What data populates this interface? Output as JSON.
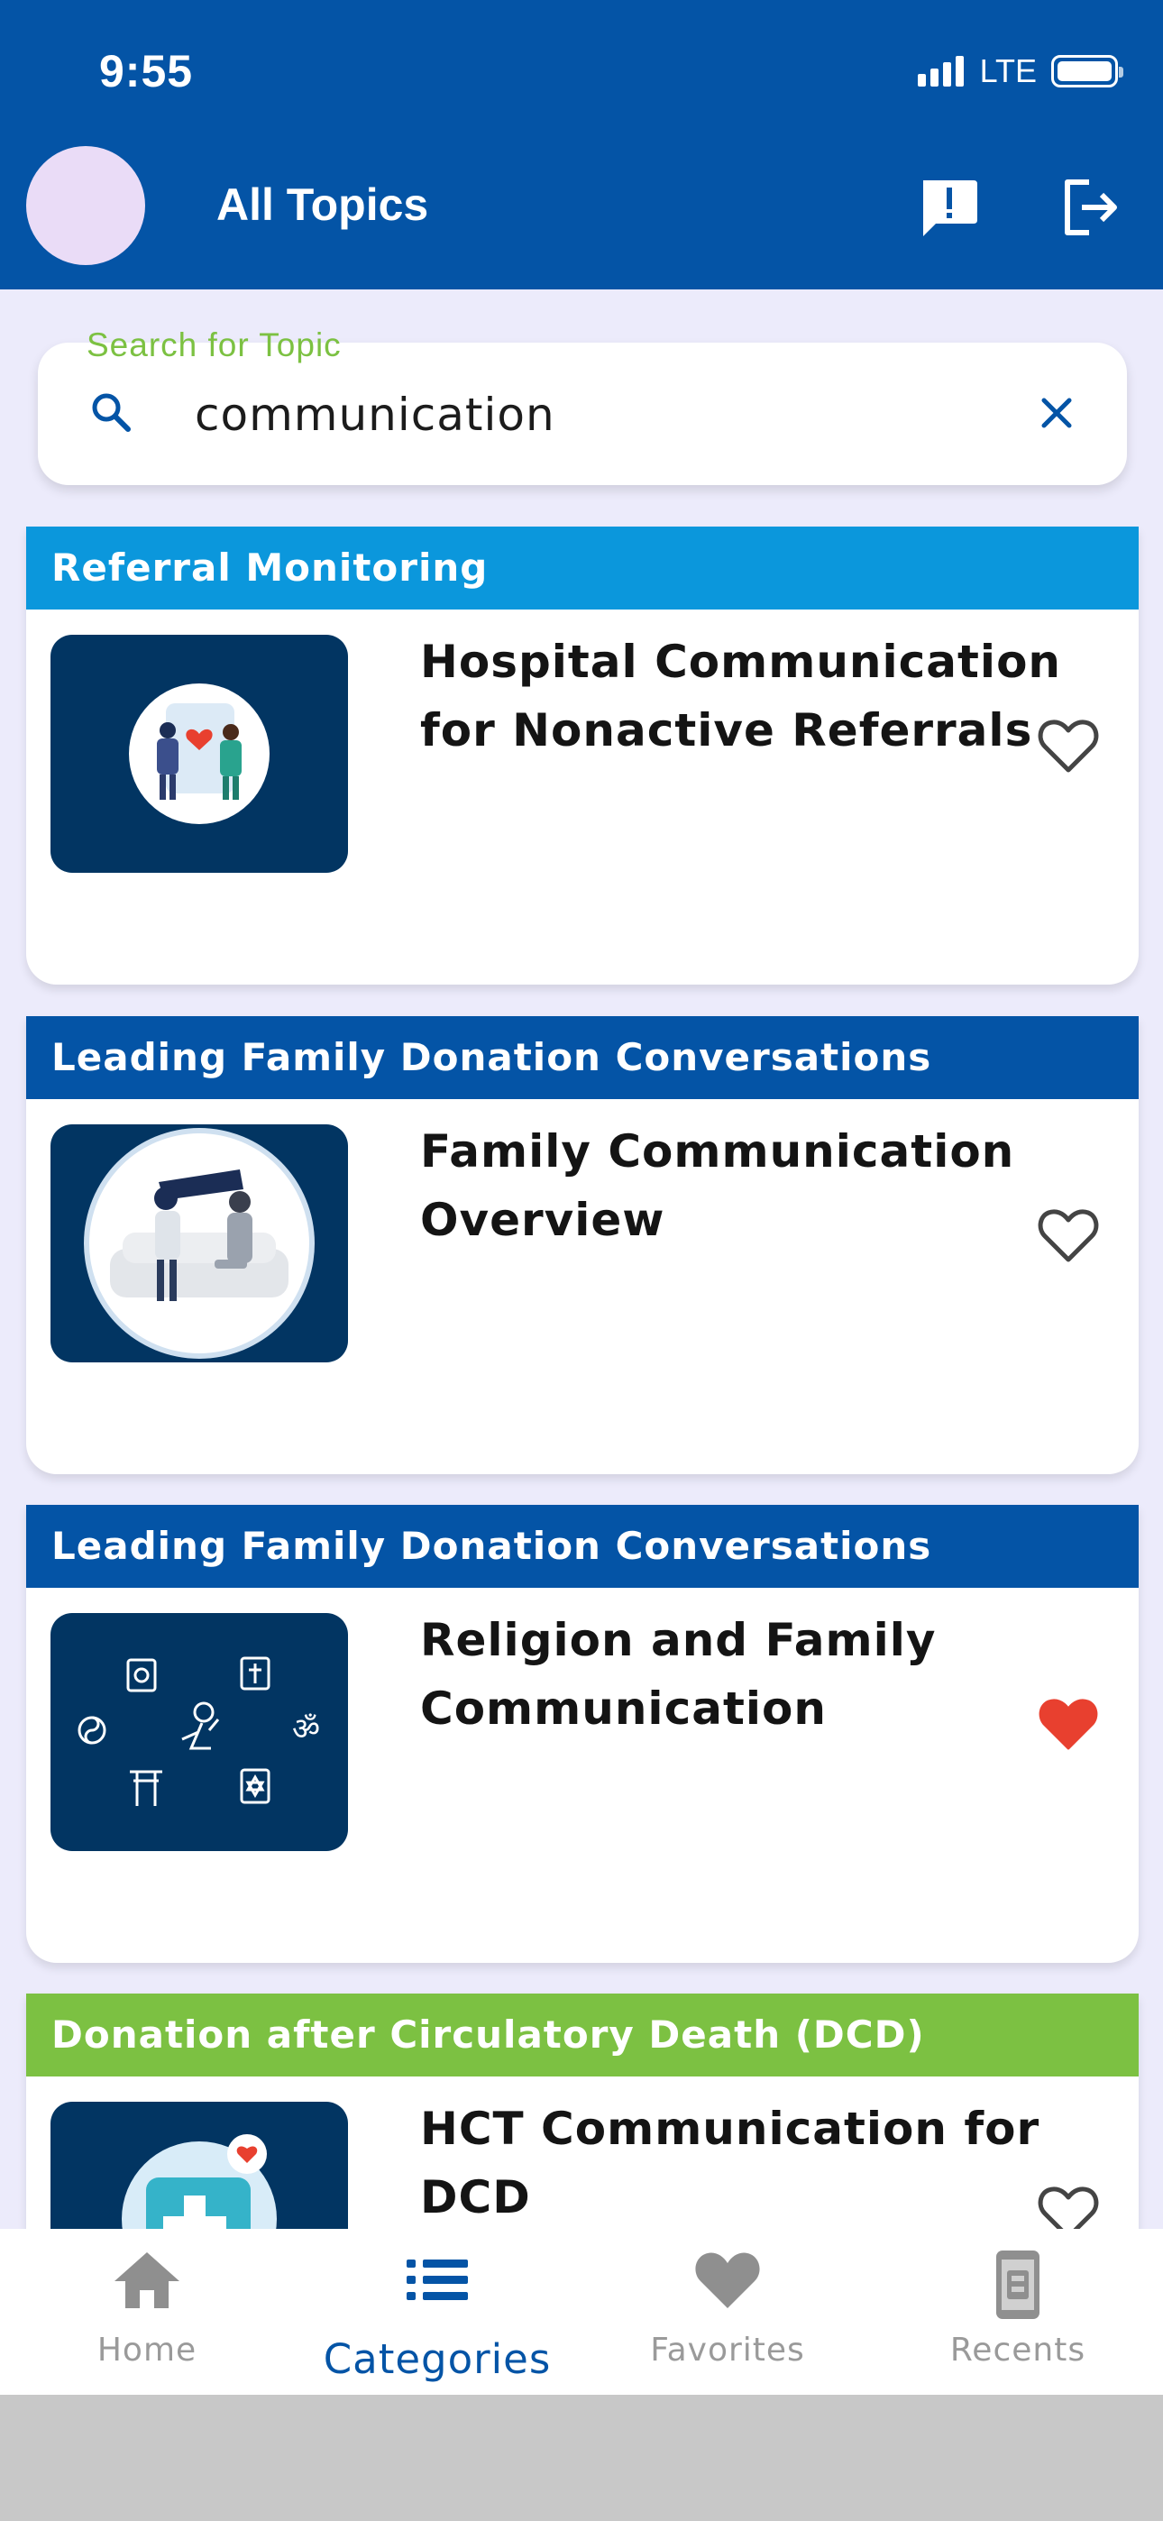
{
  "status_bar": {
    "time": "9:55",
    "network": "LTE"
  },
  "header": {
    "title": "All Topics"
  },
  "search": {
    "label": "Search for Topic",
    "value": "communication"
  },
  "colors": {
    "brand_blue": "#0454a6",
    "light_blue": "#0b97dc",
    "green": "#7cc142",
    "favorite_red": "#e8402f"
  },
  "cards": [
    {
      "category": "Referral Monitoring",
      "category_color": "#0b97dc",
      "title": "Hospital Communication for Nonactive Referrals",
      "favorite": false,
      "image_icon": "hospital-staff-illustration"
    },
    {
      "category": "Leading Family Donation Conversations",
      "category_color": "#0454a6",
      "title": "Family Communication Overview",
      "favorite": false,
      "image_icon": "family-conversation-illustration"
    },
    {
      "category": "Leading Family Donation Conversations",
      "category_color": "#0454a6",
      "title": "Religion and Family Communication",
      "favorite": true,
      "image_icon": "religion-symbols-illustration"
    },
    {
      "category": "Donation after Circulatory Death (DCD)",
      "category_color": "#7cc142",
      "title": "HCT Communication for DCD",
      "favorite": false,
      "image_icon": "medical-kit-illustration"
    }
  ],
  "nav": [
    {
      "label": "Home",
      "icon": "home-icon",
      "active": false
    },
    {
      "label": "Categories",
      "icon": "list-icon",
      "active": true
    },
    {
      "label": "Favorites",
      "icon": "heart-icon",
      "active": false
    },
    {
      "label": "Recents",
      "icon": "recents-icon",
      "active": false
    }
  ]
}
